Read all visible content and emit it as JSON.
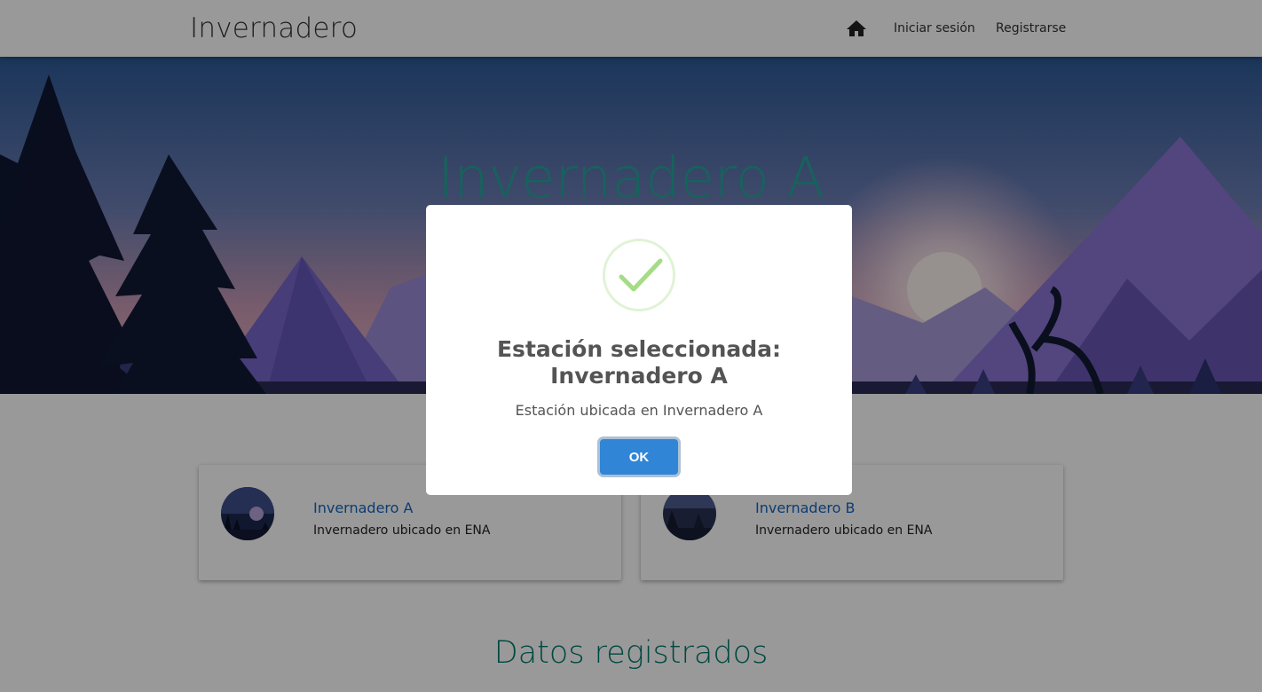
{
  "navbar": {
    "brand": "Invernadero",
    "home_icon": "home-icon",
    "login_label": "Iniciar sesión",
    "register_label": "Registrarse"
  },
  "hero": {
    "title": "Invernadero A"
  },
  "cards": [
    {
      "title": "Invernadero A",
      "description": "Invernadero ubicado en ENA"
    },
    {
      "title": "Invernadero B",
      "description": "Invernadero ubicado en ENA"
    }
  ],
  "section": {
    "title": "Datos registrados"
  },
  "modal": {
    "icon": "success-check-icon",
    "title_line1": "Estación seleccionada:",
    "title_line2": "Invernadero A",
    "text": "Estación ubicada en Invernadero A",
    "ok_label": "OK"
  },
  "colors": {
    "accent_teal": "#26a69a",
    "link_blue": "#1565c0",
    "ok_button": "#3085d6",
    "success_green": "#a5dc86"
  }
}
